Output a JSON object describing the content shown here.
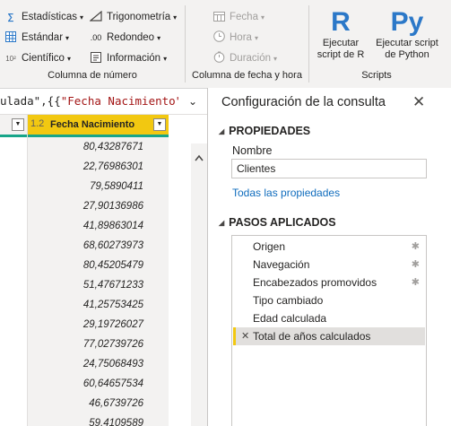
{
  "ribbon": {
    "number_group": {
      "items": [
        {
          "label": "Estadísticas",
          "icon": "sigma-icon"
        },
        {
          "label": "Trigonometría",
          "icon": "trigonometry-icon"
        },
        {
          "label": "Estándar",
          "icon": "grid-icon"
        },
        {
          "label": "Redondeo",
          "icon": "rounding-icon"
        },
        {
          "label": "Científico",
          "icon": "scientific-icon",
          "icon_text": "10²"
        },
        {
          "label": "Información",
          "icon": "information-icon"
        }
      ],
      "label": "Columna de número"
    },
    "datetime_group": {
      "items": [
        {
          "label": "Fecha",
          "icon": "calendar-icon"
        },
        {
          "label": "Hora",
          "icon": "clock-icon"
        },
        {
          "label": "Duración",
          "icon": "stopwatch-icon"
        }
      ],
      "label": "Columna de fecha y hora"
    },
    "scripts_group": {
      "r_button": {
        "line1": "Ejecutar",
        "line2": "script de R",
        "glyph": "R"
      },
      "py_button": {
        "line1": "Ejecutar script",
        "line2": "de Python",
        "glyph": "Py"
      },
      "label": "Scripts"
    }
  },
  "formula_bar": {
    "text_plain": "ulada\",{{",
    "text_string": "\"Fecha Nacimiento\","
  },
  "grid": {
    "column_header": {
      "type_badge": "1.2",
      "label": "Fecha Nacimiento"
    },
    "rows": [
      "80,43287671",
      "22,76986301",
      "79,5890411",
      "27,90136986",
      "41,89863014",
      "68,60273973",
      "80,45205479",
      "51,47671233",
      "41,25753425",
      "29,19726027",
      "77,02739726",
      "24,75068493",
      "60,64657534",
      "46,6739726",
      "59,4109589"
    ]
  },
  "query_settings": {
    "title": "Configuración de la consulta",
    "properties": {
      "heading": "PROPIEDADES",
      "name_label": "Nombre",
      "name_value": "Clientes",
      "all_properties_link": "Todas las propiedades"
    },
    "applied_steps": {
      "heading": "PASOS APLICADOS",
      "steps": [
        {
          "label": "Origen",
          "has_gear": true
        },
        {
          "label": "Navegación",
          "has_gear": true
        },
        {
          "label": "Encabezados promovidos",
          "has_gear": true
        },
        {
          "label": "Tipo cambiado",
          "has_gear": false
        },
        {
          "label": "Edad calculada",
          "has_gear": false
        },
        {
          "label": "Total de años calculados",
          "has_gear": false,
          "selected": true
        }
      ]
    }
  },
  "colors": {
    "ribbon_bg": "#f3f2f1",
    "accent_yellow": "#f2c811",
    "column_quality_bar": "#17a589",
    "link_blue": "#0f6cbd",
    "script_icon_blue": "#2b78c8"
  }
}
